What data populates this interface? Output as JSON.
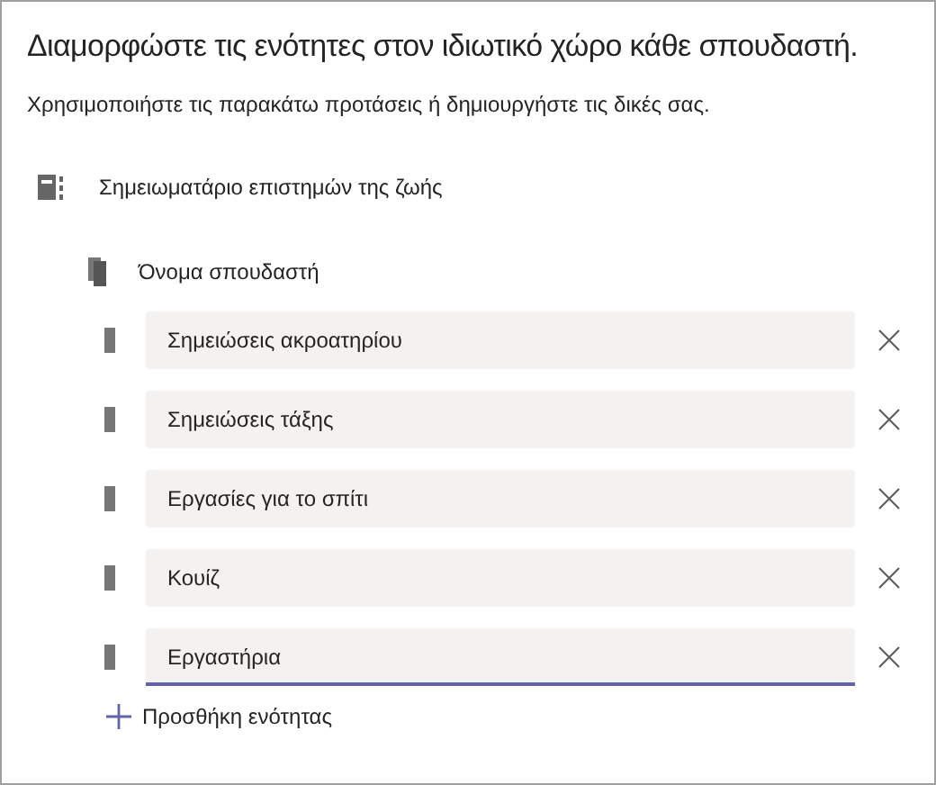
{
  "title": "Διαμορφώστε τις ενότητες στον ιδιωτικό χώρο κάθε σπουδαστή.",
  "subtitle": "Χρησιμοποιήστε τις παρακάτω προτάσεις ή δημιουργήστε τις δικές σας.",
  "notebook": {
    "name": "Σημειωματάριο επιστημών της ζωής"
  },
  "student": {
    "name": "Όνομα σπουδαστή"
  },
  "sections": [
    {
      "value": "Σημειώσεις ακροατηρίου",
      "focused": false
    },
    {
      "value": "Σημειώσεις τάξης",
      "focused": false
    },
    {
      "value": "Εργασίες για το σπίτι",
      "focused": false
    },
    {
      "value": "Κουίζ",
      "focused": false
    },
    {
      "value": "Εργαστήρια",
      "focused": true
    }
  ],
  "add_button": {
    "label": "Προσθήκη ενότητας"
  }
}
